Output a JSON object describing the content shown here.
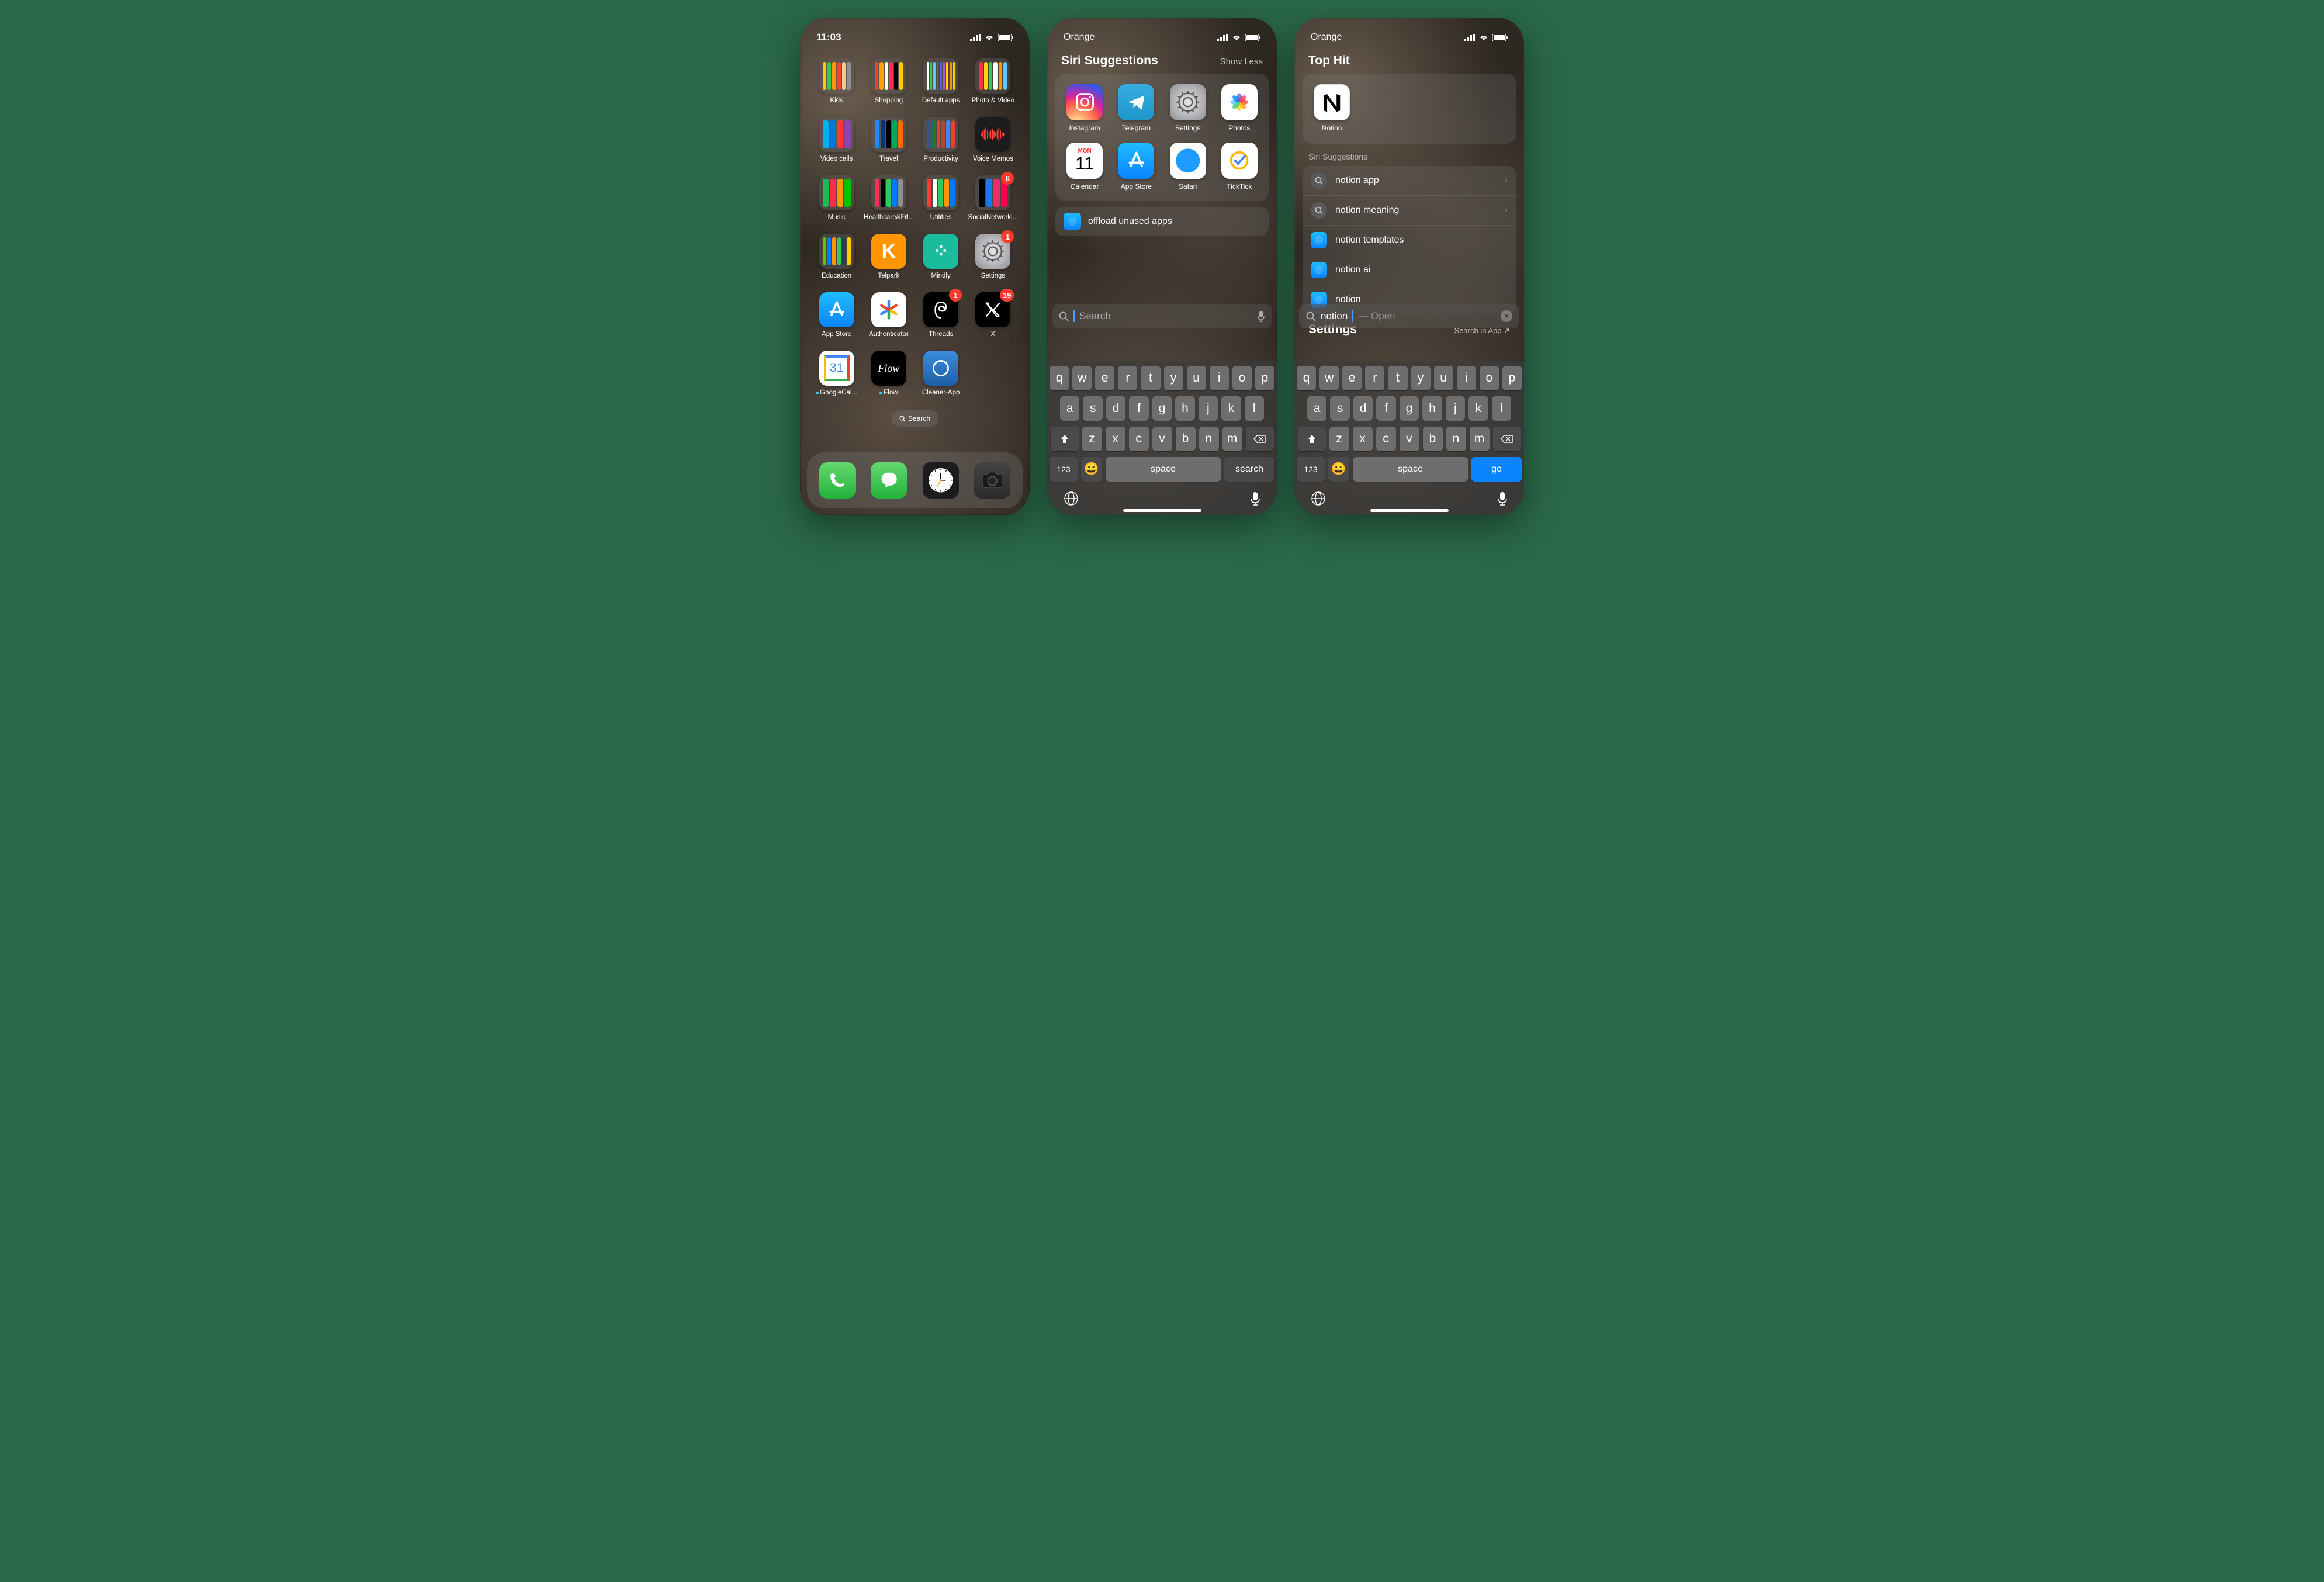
{
  "screen1": {
    "time": "11:03",
    "folders": [
      {
        "label": "Kids",
        "colors": [
          "#ffcd00",
          "#34c759",
          "#ff9500",
          "#ff3b30",
          "#e6d28a",
          "#8e8e93"
        ]
      },
      {
        "label": "Shopping",
        "colors": [
          "#ff3b30",
          "#ff9f0a",
          "#ffffff",
          "#ff2d55",
          "#000000",
          "#ffcc00"
        ]
      },
      {
        "label": "Default apps",
        "colors": [
          "#ffffff",
          "#34c759",
          "#5ac8fa",
          "#007aff",
          "#5e5ce6",
          "#af52de",
          "#ffd60a",
          "#ff9500",
          "#ffcc00"
        ]
      },
      {
        "label": "Photo & Video",
        "colors": [
          "#ff2d55",
          "#ffd60a",
          "#34c759",
          "#ffffff",
          "#ff9500",
          "#5ac8fa"
        ]
      },
      {
        "label": "Video calls",
        "colors": [
          "#00aff0",
          "#0078d4",
          "#ff3b30",
          "#8e44ad"
        ]
      },
      {
        "label": "Travel",
        "colors": [
          "#1a8cff",
          "#003580",
          "#000000",
          "#00a859",
          "#ff6b00"
        ]
      },
      {
        "label": "Productivity",
        "colors": [
          "#2b579a",
          "#217346",
          "#d24726",
          "#b7472a",
          "#4285f4",
          "#ea4335"
        ]
      },
      {
        "label": "Voice Memos",
        "icon": "voicememos",
        "single": true
      },
      {
        "label": "Music",
        "colors": [
          "#1db954",
          "#fa2e46",
          "#ff9500",
          "#00c300"
        ]
      },
      {
        "label": "Healthcare&Fit...",
        "colors": [
          "#ff2d55",
          "#000000",
          "#34c759",
          "#007aff",
          "#8e8e93"
        ]
      },
      {
        "label": "Utilities",
        "colors": [
          "#ff3b30",
          "#ffffff",
          "#34c759",
          "#ff9500",
          "#007aff"
        ]
      },
      {
        "label": "SocialNetworki...",
        "colors": [
          "#000000",
          "#1877f2",
          "#e1306c",
          "#ff0050"
        ],
        "badge": "6"
      },
      {
        "label": "Education",
        "colors": [
          "#58cc02",
          "#007aff",
          "#ff9500",
          "#34c759",
          "#2c3e50",
          "#ffcc00"
        ]
      }
    ],
    "apps": [
      {
        "label": "Telpark",
        "bg": "#ff9500",
        "glyph": "K",
        "fg": "#fff"
      },
      {
        "label": "Mindly",
        "bg": "#1abc9c",
        "glyph": "⁘",
        "fg": "#fff"
      },
      {
        "label": "Settings",
        "icon": "settings",
        "badge": "1"
      },
      {
        "label": "App Store",
        "icon": "appstore"
      },
      {
        "label": "Authenticator",
        "icon": "authenticator"
      },
      {
        "label": "Threads",
        "icon": "threads",
        "badge": "1"
      },
      {
        "label": "X",
        "icon": "x",
        "badge": "19"
      },
      {
        "label": "GoogleCal...",
        "icon": "gcal",
        "dot": true
      },
      {
        "label": "Flow",
        "icon": "flow",
        "dot": true
      },
      {
        "label": "Cleaner-App",
        "icon": "cleaner"
      }
    ],
    "search_label": "Search",
    "dock": [
      "phone",
      "messages",
      "clock",
      "camera"
    ]
  },
  "screen2": {
    "carrier": "Orange",
    "title": "Siri Suggestions",
    "show_less": "Show Less",
    "sugg": [
      {
        "label": "Instagram",
        "icon": "instagram"
      },
      {
        "label": "Telegram",
        "icon": "telegram"
      },
      {
        "label": "Settings",
        "icon": "settings"
      },
      {
        "label": "Photos",
        "icon": "photos"
      },
      {
        "label": "Calendar",
        "icon": "calendar",
        "cal_day": "11",
        "cal_dow": "MON"
      },
      {
        "label": "App Store",
        "icon": "appstore"
      },
      {
        "label": "Safari",
        "icon": "safari"
      },
      {
        "label": "TickTick",
        "icon": "ticktick"
      }
    ],
    "quick": {
      "label": "offload unused apps",
      "icon": "safari-small"
    },
    "search_placeholder": "Search",
    "kb_return": "search"
  },
  "screen3": {
    "carrier": "Orange",
    "tophit_title": "Top Hit",
    "tophit": {
      "label": "Notion",
      "icon": "notion"
    },
    "siri_title": "Siri Suggestions",
    "siri": [
      {
        "label": "notion app",
        "icon": "search",
        "chev": true
      },
      {
        "label": "notion meaning",
        "icon": "search",
        "chev": true
      },
      {
        "label": "notion templates",
        "icon": "safari-small"
      },
      {
        "label": "notion ai",
        "icon": "safari-small"
      },
      {
        "label": "notion",
        "icon": "safari-small"
      }
    ],
    "settings_title": "Settings",
    "settings_link": "Search in App",
    "search_value": "notion",
    "search_hint": " — Open",
    "kb_return": "go"
  },
  "keyboard": {
    "row1": [
      "q",
      "w",
      "e",
      "r",
      "t",
      "y",
      "u",
      "i",
      "o",
      "p"
    ],
    "row2": [
      "a",
      "s",
      "d",
      "f",
      "g",
      "h",
      "j",
      "k",
      "l"
    ],
    "row3": [
      "z",
      "x",
      "c",
      "v",
      "b",
      "n",
      "m"
    ],
    "num": "123",
    "space": "space"
  }
}
